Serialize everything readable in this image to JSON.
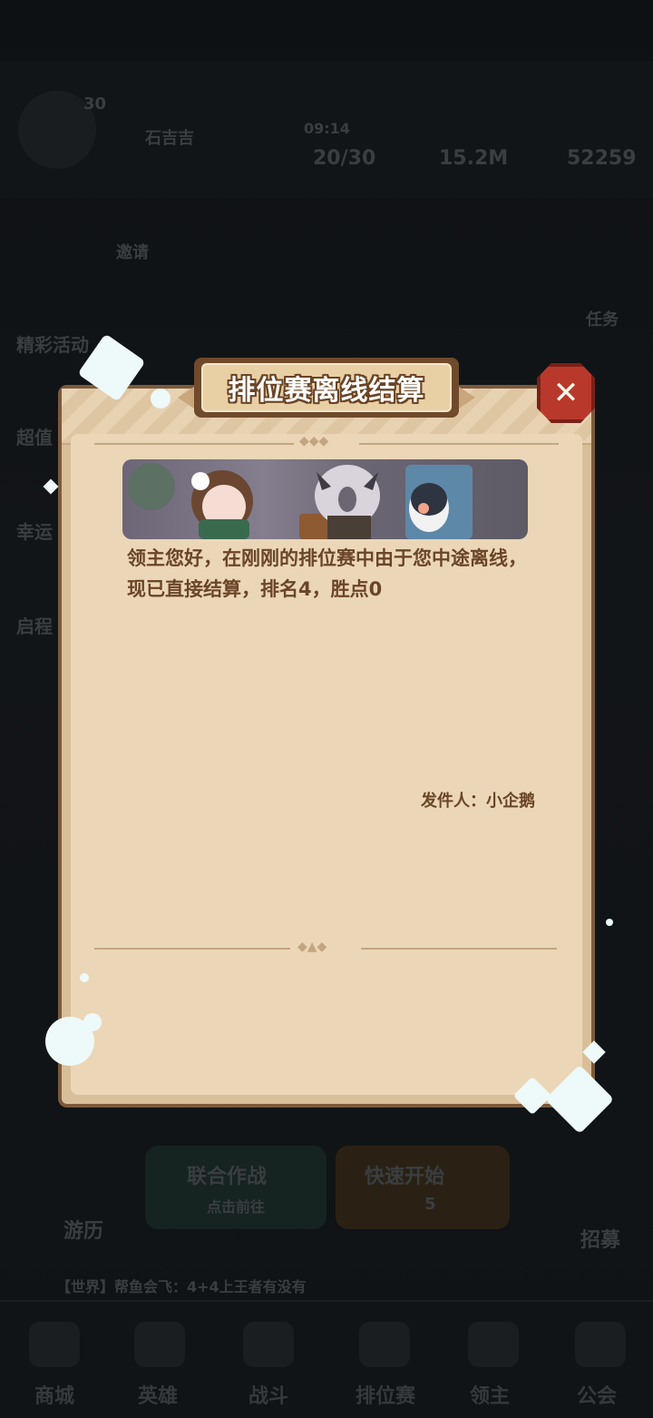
{
  "modal": {
    "title": "排位赛离线结算",
    "message": "领主您好，在刚刚的排位赛中由于您中途离线，现已直接结算，排名4，胜点0",
    "sender_label": "发件人：小企鹅"
  },
  "background": {
    "player_name": "石吉吉",
    "level": "30",
    "timer": "09:14",
    "stamina": "20/30",
    "gold": "15.2M",
    "gems": "52259",
    "invite": "邀请",
    "events": "精彩活动",
    "tasks": "任务",
    "value": "超值",
    "lucky": "幸运",
    "journey": "启程",
    "joint_battle": "联合作战",
    "joint_battle_sub": "点击前往",
    "quick_start": "快速开始",
    "quick_start_cost": "5",
    "travel": "游历",
    "recruit": "招募",
    "chat": "【世界】帮鱼会飞：4+4上王者有没有",
    "tabs": [
      "商城",
      "英雄",
      "战斗",
      "排位赛",
      "领主",
      "公会"
    ]
  },
  "colors": {
    "panel": "#ebd7b7",
    "frame": "#7b5a3c",
    "text": "#6b4528",
    "close": "#b8392c"
  }
}
